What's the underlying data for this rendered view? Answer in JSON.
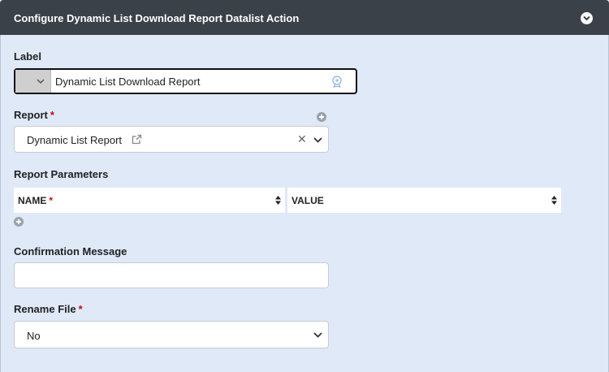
{
  "header": {
    "title": "Configure Dynamic List Download Report Datalist Action",
    "collapse_icon": "chevron-circle-down-icon"
  },
  "label_field": {
    "label": "Label",
    "value": "Dynamic List Download Report",
    "translate_icon": "translate-icon"
  },
  "report_field": {
    "label": "Report",
    "required_mark": "*",
    "selected": "Dynamic List Report",
    "clear_glyph": "✕"
  },
  "report_parameters": {
    "label": "Report Parameters",
    "columns": [
      {
        "label": "NAME",
        "required_mark": "*"
      },
      {
        "label": "VALUE",
        "required_mark": ""
      }
    ]
  },
  "confirmation": {
    "label": "Confirmation Message",
    "value": ""
  },
  "rename_file": {
    "label": "Rename File",
    "required_mark": "*",
    "selected": "No"
  },
  "colors": {
    "header_bg": "#3b4148",
    "panel_bg": "#dfe9f8",
    "required": "#d0021b"
  }
}
